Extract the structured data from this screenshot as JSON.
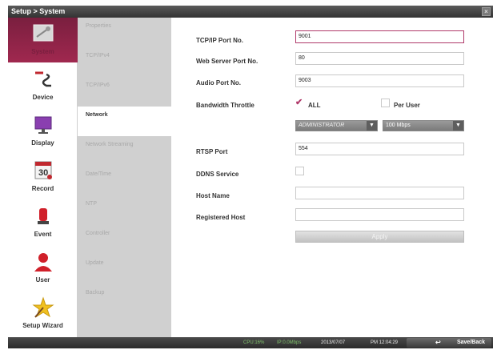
{
  "title": "Setup > System",
  "close_glyph": "×",
  "left_menu": [
    {
      "label": "System",
      "icon": "system-icon"
    },
    {
      "label": "Device",
      "icon": "device-icon"
    },
    {
      "label": "Display",
      "icon": "display-icon"
    },
    {
      "label": "Record",
      "icon": "record-icon"
    },
    {
      "label": "Event",
      "icon": "event-icon"
    },
    {
      "label": "User",
      "icon": "user-icon"
    },
    {
      "label": "Setup Wizard",
      "icon": "setup-wizard-icon"
    }
  ],
  "sub_menu": [
    {
      "label": "Properties"
    },
    {
      "label": "TCP/IPv4"
    },
    {
      "label": "TCP/IPv6"
    },
    {
      "label": "Network"
    },
    {
      "label": "Network Streaming"
    },
    {
      "label": "Date/Time"
    },
    {
      "label": "NTP"
    },
    {
      "label": "Controller"
    },
    {
      "label": "Update"
    },
    {
      "label": "Backup"
    }
  ],
  "form": {
    "tcp_port_label": "TCP/IP Port No.",
    "tcp_port_value": "9001",
    "web_port_label": "Web Server Port No.",
    "web_port_value": "80",
    "audio_port_label": "Audio Port No.",
    "audio_port_value": "9003",
    "bandwidth_label": "Bandwidth Throttle",
    "all_label": "ALL",
    "per_user_label": "Per User",
    "user_select_value": "ADMINISTRATOR",
    "speed_select_value": "100 Mbps",
    "rtsp_label": "RTSP Port",
    "rtsp_value": "554",
    "ddns_label": "DDNS Service",
    "host_name_label": "Host Name",
    "host_name_value": "",
    "registered_host_label": "Registered Host",
    "registered_host_value": "",
    "apply_label": "Apply"
  },
  "status_bar": {
    "cpu": "CPU:16%",
    "ip": "IP:0.0Mbps",
    "date": "2013/07/07",
    "time": "PM 12:04:29",
    "save_back": "Save/Back"
  },
  "colors": {
    "accent": "#b03a6a",
    "menu_active": "#7a1f3f",
    "status_green": "#7fc06b"
  }
}
